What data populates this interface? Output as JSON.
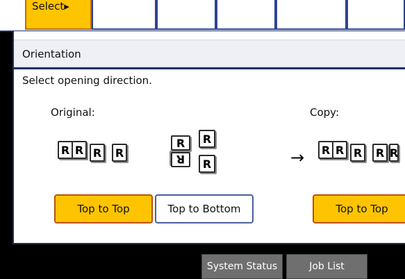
{
  "tabs": {
    "active_label": "Select▸",
    "count_additional": 5
  },
  "orientation": {
    "title": "Orientation",
    "prompt": "Select opening direction.",
    "original_label": "Original:",
    "copy_label": "Copy:",
    "page_letter": "R",
    "arrow": "→"
  },
  "buttons": {
    "original_top_to_top": "Top to Top",
    "original_top_to_bottom": "Top to Bottom",
    "copy_top_to_top": "Top to Top"
  },
  "statusbar": {
    "system_status": "System Status",
    "job_list": "Job List"
  },
  "colors": {
    "accent": "#ffc400",
    "selected_border": "#c04f00",
    "frame": "#22305f"
  }
}
